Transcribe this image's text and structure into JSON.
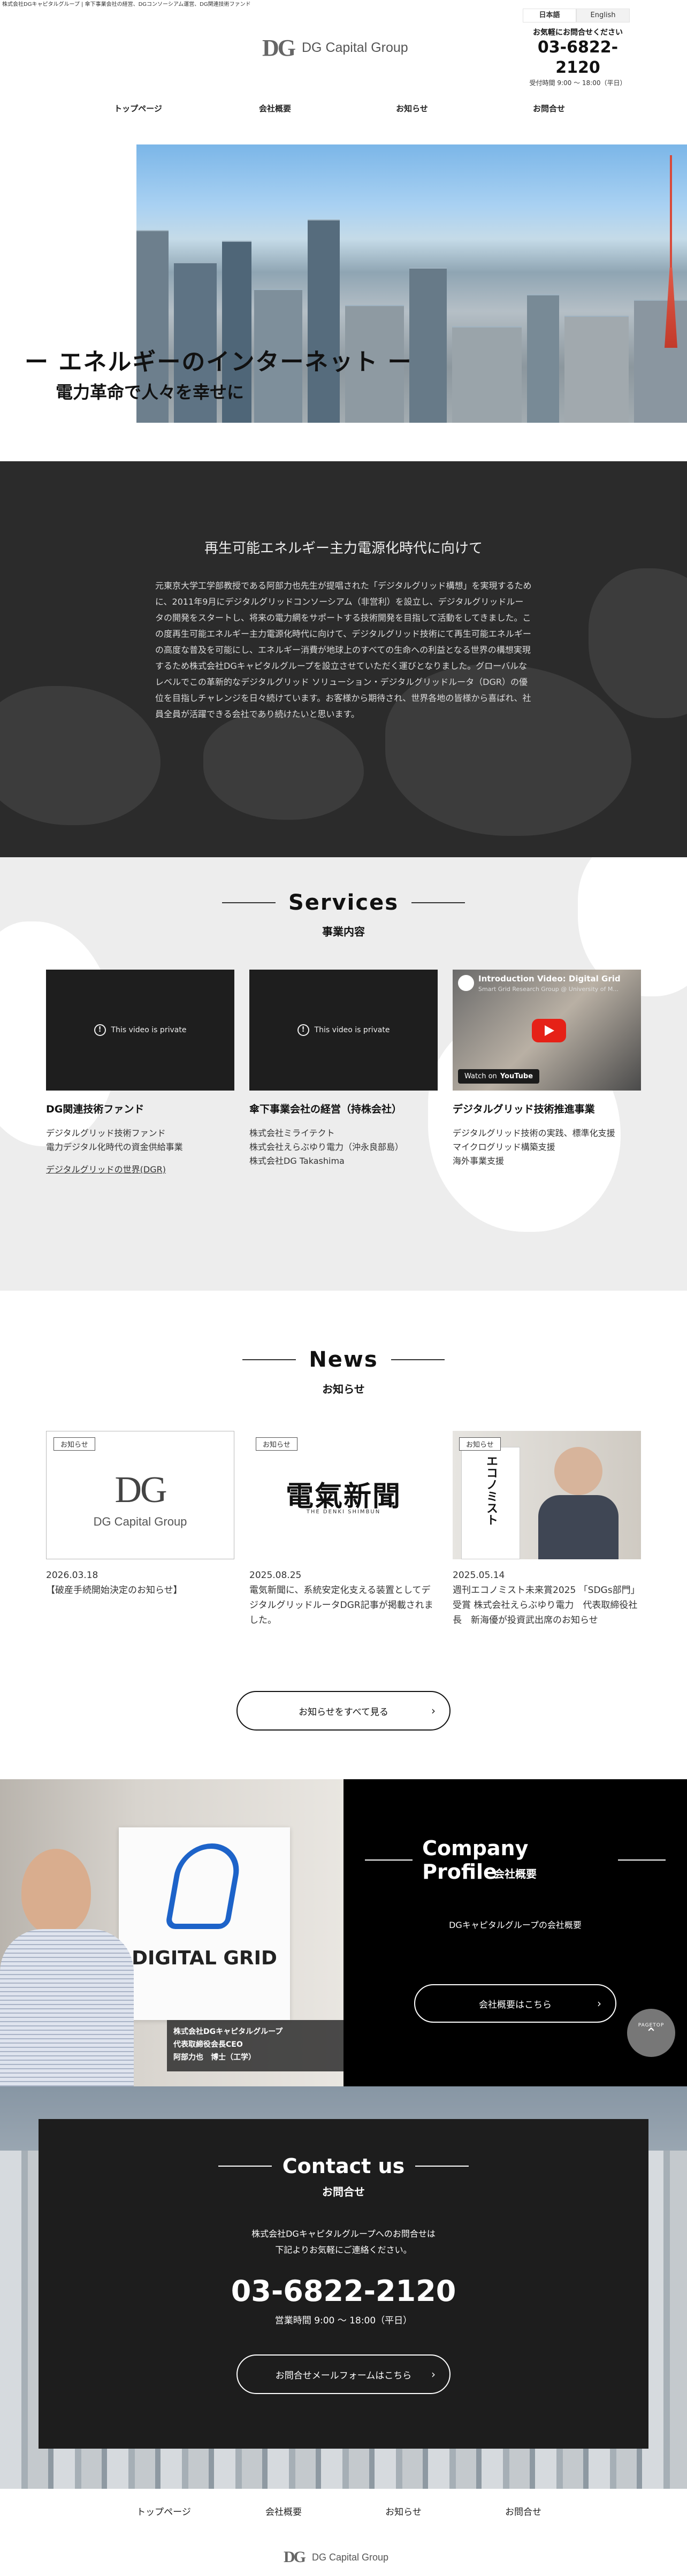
{
  "header": {
    "tagline": "株式会社DGキャピタルグループ | 傘下事業会社の経営、DGコンソーシアム運営、DG関連技術ファンド",
    "logo_mark": "DG",
    "logo_text": "DG Capital Group",
    "lang": [
      "日本語",
      "English"
    ],
    "contact_prompt": "お気軽にお問合せください",
    "phone": "03-6822-2120",
    "hours": "受付時間 9:00 ～ 18:00（平日）"
  },
  "nav": [
    "トップページ",
    "会社概要",
    "お知らせ",
    "お問合せ"
  ],
  "hero": {
    "title": "ー エネルギーのインターネット ー",
    "subtitle": "電力革命で人々を幸せに"
  },
  "intro": {
    "heading": "再生可能エネルギー主力電源化時代に向けて",
    "body": "元東京大学工学部教授である阿部力也先生が提唱された「デジタルグリッド構想」を実現するために、2011年9月にデジタルグリッドコンソーシアム（非営利）を設立し、デジタルグリッドルータの開発をスタートし、将来の電力網をサポートする技術開発を目指して活動をしてきました。この度再生可能エネルギー主力電源化時代に向けて、デジタルグリッド技術にて再生可能エネルギーの高度な普及を可能にし、エネルギー消費が地球上のすべての生命への利益となる世界の構想実現するため株式会社DGキャピタルグループを設立させていただく運びとなりました。グローバルなレベルでこの革新的なデジタルグリッド ソリューション・デジタルグリッドルータ（DGR）の優位を目指しチャレンジを日々続けています。お客様から期待され、世界各地の皆様から喜ばれ、社員全員が活躍できる会社であり続けたいと思います。"
  },
  "services": {
    "title": "Services",
    "subtitle": "事業内容",
    "private_text": "This video is private",
    "youtube": {
      "title": "Introduction Video: Digital Grid",
      "channel": "Smart Grid Research Group @ University of M...",
      "watch_on": "Watch on",
      "brand": "YouTube"
    },
    "items": [
      {
        "heading": "DG関連技術ファンド",
        "lines": [
          "デジタルグリッド技術ファンド",
          "電力デジタル化時代の資金供給事業"
        ],
        "link": "デジタルグリッドの世界(DGR)"
      },
      {
        "heading": "傘下事業会社の経営（持株会社）",
        "lines": [
          "株式会社ミライテクト",
          "株式会社えらぶゆり電力（沖永良部島）",
          "株式会社DG Takashima"
        ],
        "link": ""
      },
      {
        "heading": "デジタルグリッド技術推進事業",
        "lines": [
          "デジタルグリッド技術の実践、標準化支援",
          "マイクログリッド構築支援",
          "海外事業支援"
        ],
        "link": ""
      }
    ]
  },
  "news": {
    "title": "News",
    "subtitle": "お知らせ",
    "badge": "お知らせ",
    "items": [
      {
        "date": "2026.03.18",
        "text": "【破産手続開始決定のお知らせ】"
      },
      {
        "date": "2025.08.25",
        "text": "電気新聞に、系統安定化支える装置としてデジタルグリッドルータDGR記事が掲載されました。"
      },
      {
        "date": "2025.05.14",
        "text": "週刊エコノミスト未来賞2025 「SDGs部門」受賞 株式会社えらぶゆり電力　代表取締役社長　新海優が投資武出席のお知らせ"
      }
    ],
    "newspaper_title": "電氣新聞",
    "newspaper_sub": "THE DENKI SHIMBUN",
    "magazine": "エコノミスト",
    "button": "お知らせをすべて見る"
  },
  "profile": {
    "title": "Company Profile",
    "subtitle": "会社概要",
    "text": "DGキャピタルグループの会社概要",
    "button": "会社概要はこちら",
    "caption": [
      "株式会社DGキャピタルグループ",
      "代表取締役会長CEO",
      "阿部力也　博士（工学）"
    ],
    "sign_text": "DIGITAL GRID",
    "pagetop": "PAGETOP"
  },
  "contact": {
    "title": "Contact us",
    "subtitle": "お問合せ",
    "text1": "株式会社DGキャピタルグループへのお問合せは",
    "text2": "下記よりお気軽にご連絡ください。",
    "phone": "03-6822-2120",
    "hours": "営業時間 9:00 ～ 18:00（平日）",
    "button": "お問合せメールフォームはこちら"
  },
  "footer": {
    "nav": [
      "トップページ",
      "会社概要",
      "お知らせ",
      "お問合せ"
    ],
    "logo_text": "DG Capital Group"
  },
  "colors": {
    "dark": "#2b2b2b",
    "black": "#000000",
    "accent_red": "#e03a2f"
  }
}
